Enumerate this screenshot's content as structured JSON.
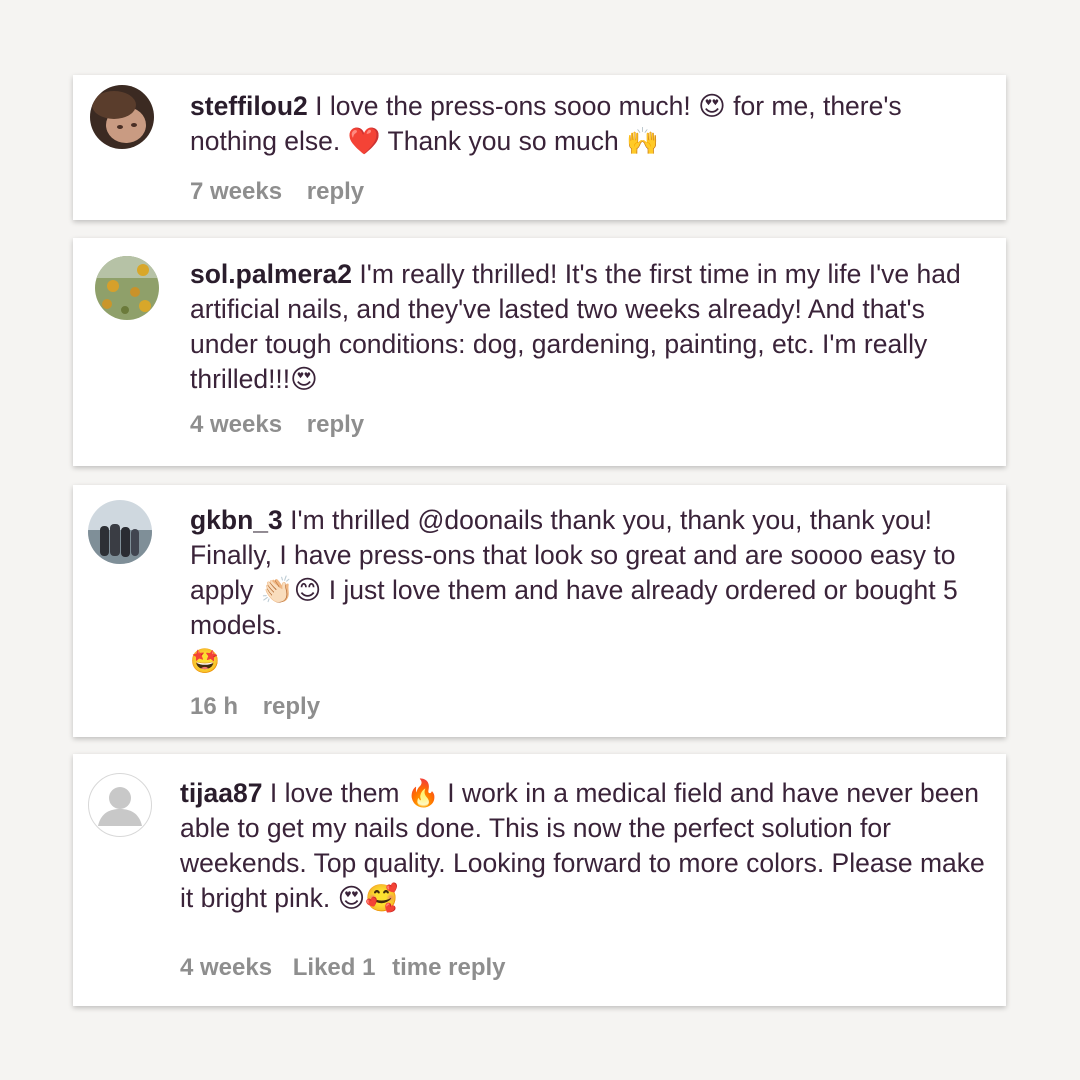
{
  "comments": [
    {
      "username": "steffilou2",
      "text": "I love the press-ons sooo much! 😍 for me, there's nothing else. ❤️ Thank you so much 🙌",
      "time": "7 weeks",
      "reply": "reply"
    },
    {
      "username": "sol.palmera2",
      "text": "I'm really thrilled! It's the first time in my life I've had artificial nails, and they've lasted two weeks already! And that's under tough conditions: dog, gardening, painting, etc. I'm really thrilled!!!😍",
      "time": "4 weeks",
      "reply": "reply"
    },
    {
      "username": "gkbn_3",
      "text": "I'm thrilled @doonails thank you, thank you, thank you! Finally, I have press-ons that look so great and are soooo easy to apply 👏🏻😊 I just love them and have already ordered or bought 5 models.",
      "text_extra": "🤩",
      "time": "16 h",
      "reply": "reply"
    },
    {
      "username": "tijaa87",
      "text": "I love them 🔥 I work in a medical field and have never been able to get my nails done. This is now the perfect solution for weekends. Top quality. Looking forward to more colors. Please make it bright pink. 😍🥰",
      "time": "4 weeks",
      "liked": "Liked 1",
      "reply": "time reply"
    }
  ]
}
